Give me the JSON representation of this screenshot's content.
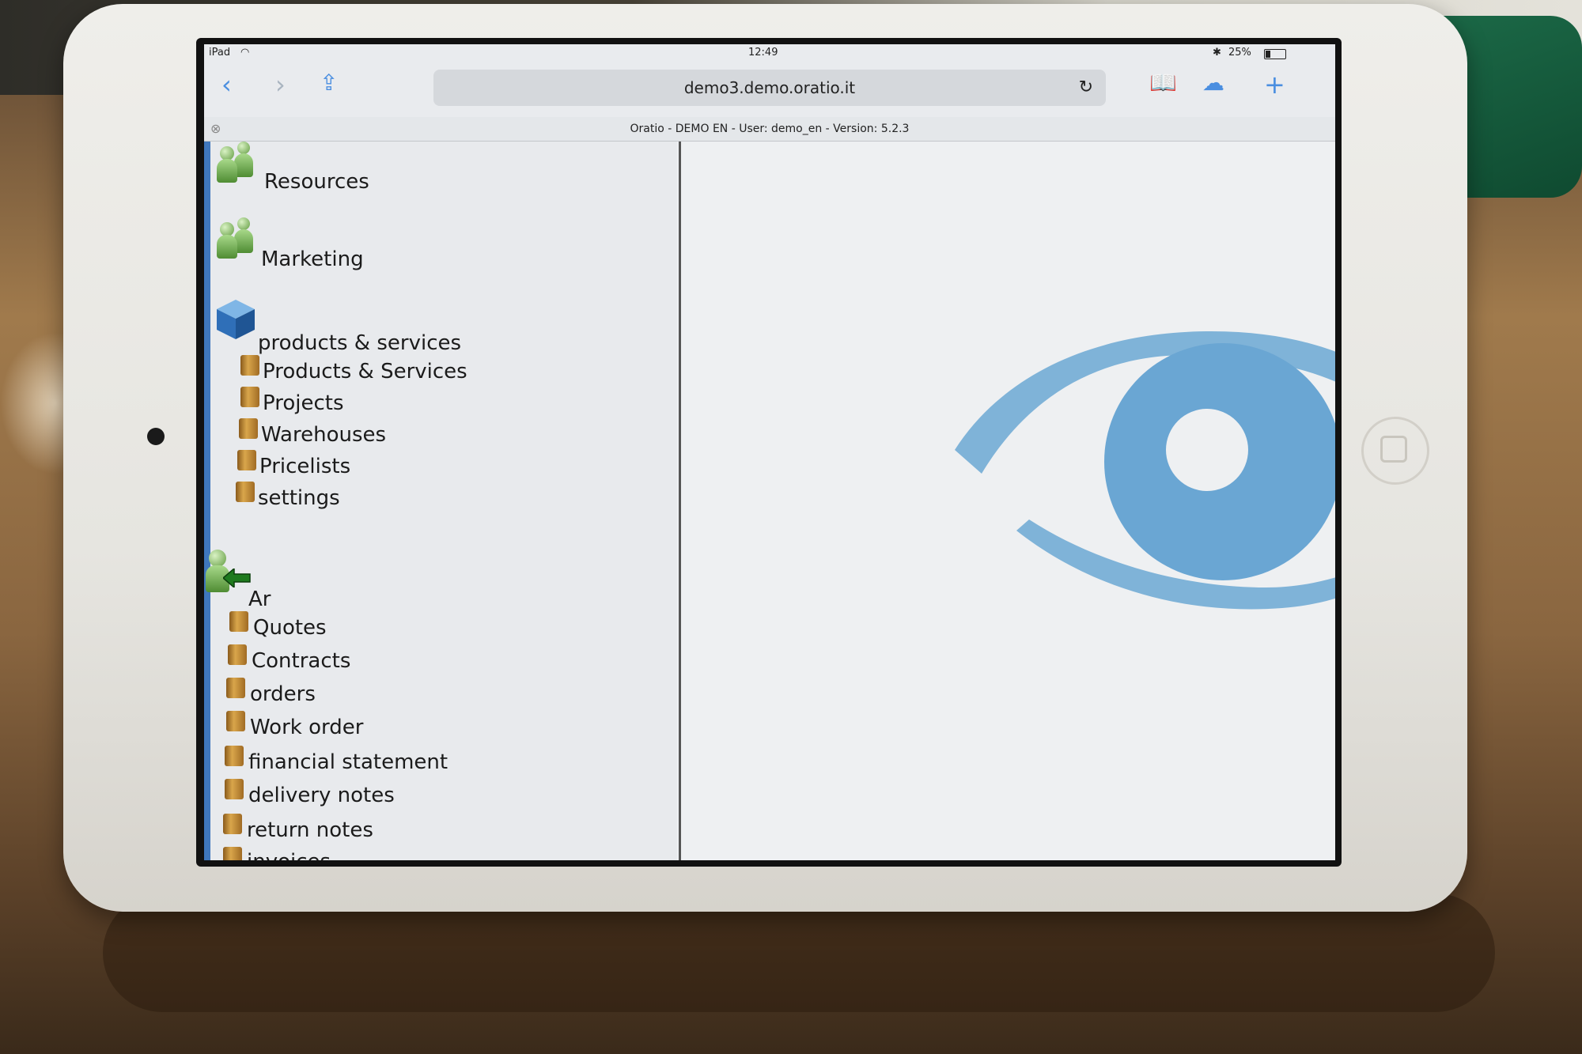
{
  "status_bar": {
    "device": "iPad",
    "time": "12:49",
    "battery": "25%"
  },
  "toolbar": {
    "url": "demo3.demo.oratio.it",
    "icons": [
      "back-icon",
      "forward-icon",
      "share-icon",
      "reload-icon",
      "bookmarks-icon",
      "icloud-tabs-icon",
      "new-tab-icon"
    ]
  },
  "page_title": "Oratio - DEMO EN - User: demo_en - Version: 5.2.3",
  "menu": {
    "resources": {
      "label": "Resources",
      "icon": "users-icon"
    },
    "marketing": {
      "label": "Marketing",
      "icon": "users-icon"
    },
    "products": {
      "label": "products & services",
      "icon": "cube-icon",
      "items": [
        "Products & Services",
        "Projects",
        "Warehouses",
        "Pricelists",
        "settings"
      ]
    },
    "ar": {
      "label": "Ar",
      "icon": "user-arrow-icon",
      "items": [
        "Quotes",
        "Contracts",
        "orders",
        "Work order",
        "financial statement",
        "delivery notes",
        "return notes",
        "invoices"
      ]
    }
  },
  "colors": {
    "accent": "#3f77bd",
    "logo": "#7fb3d8",
    "link": "#4a8ee0"
  }
}
